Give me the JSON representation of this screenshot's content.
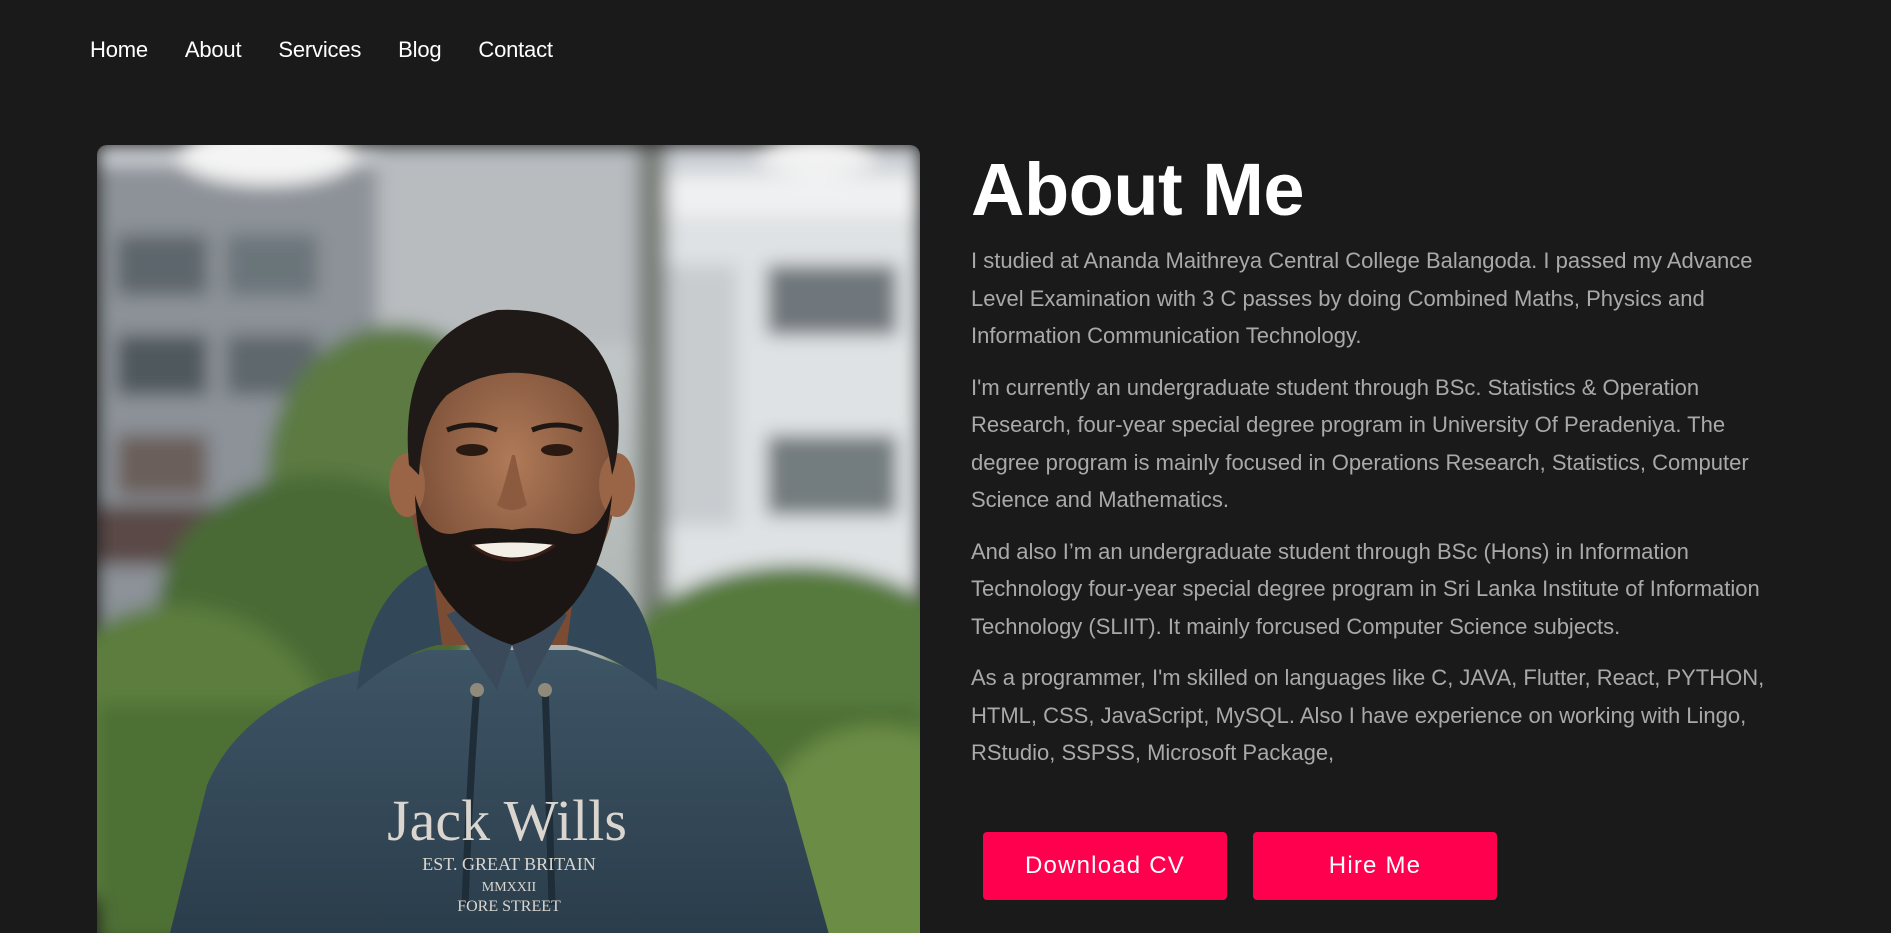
{
  "nav": {
    "items": [
      "Home",
      "About",
      "Services",
      "Blog",
      "Contact"
    ]
  },
  "photo": {
    "subject": "portrait",
    "hoodie_text": {
      "line1": "Jack Wills",
      "line2": "EST. GREAT BRITAIN",
      "line3": "MMXXII",
      "line4": "FORE STREET"
    }
  },
  "about": {
    "title": "About Me",
    "paragraphs": [
      "I studied at Ananda Maithreya Central College Balangoda. I passed my Advance Level Examination with 3 C passes by doing Combined Maths, Physics and Information Communication Technology.",
      "I'm currently an undergraduate student through BSc. Statistics & Operation Research, four-year special degree program in University Of Peradeniya. The degree program is mainly focused in Operations Research, Statistics, Computer Science and Mathematics.",
      "And also I’m an undergraduate student through BSc (Hons) in Information Technology four-year special degree program in Sri Lanka Institute of Information Technology (SLIIT). It mainly forcused Computer Science subjects.",
      "As a programmer, I'm skilled on languages like C, JAVA, Flutter, React, PYTHON, HTML, CSS, JavaScript, MySQL. Also I have experience on working with Lingo, RStudio, SSPSS, Microsoft Package,"
    ],
    "download_cv_label": "Download CV",
    "hire_me_label": "Hire Me"
  },
  "colors": {
    "background": "#1a1a1a",
    "accent": "#ff004f",
    "text_primary": "#ffffff",
    "text_secondary": "#a9a9a9"
  }
}
